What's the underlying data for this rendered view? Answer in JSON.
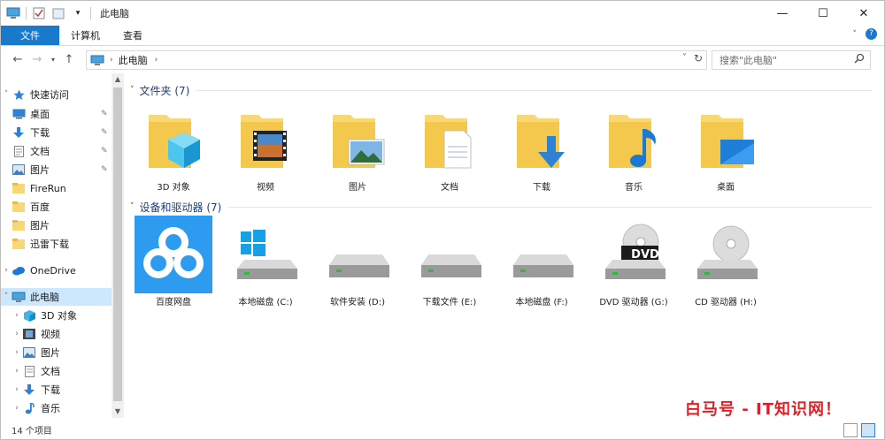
{
  "window": {
    "title": "此电脑",
    "minimize": "—",
    "maximize": "☐",
    "close": "✕"
  },
  "ribbon": {
    "tabs": [
      "文件",
      "计算机",
      "查看"
    ],
    "help": "?"
  },
  "address": {
    "crumb": "此电脑",
    "chevron": "›"
  },
  "search": {
    "placeholder": "搜索\"此电脑\""
  },
  "nav": {
    "quick_access": "快速访问",
    "quick_items": [
      "桌面",
      "下载",
      "文档",
      "图片",
      "FireRun",
      "百度",
      "图片",
      "迅雷下载"
    ],
    "onedrive": "OneDrive",
    "this_pc": "此电脑",
    "pc_items": [
      "3D 对象",
      "视频",
      "图片",
      "文档",
      "下载",
      "音乐"
    ]
  },
  "groups": {
    "folders_title": "文件夹 (7)",
    "devices_title": "设备和驱动器 (7)"
  },
  "folders": [
    {
      "label": "3D 对象",
      "icon": "3d-objects-folder-icon"
    },
    {
      "label": "视频",
      "icon": "videos-folder-icon"
    },
    {
      "label": "图片",
      "icon": "pictures-folder-icon"
    },
    {
      "label": "文档",
      "icon": "documents-folder-icon"
    },
    {
      "label": "下载",
      "icon": "downloads-folder-icon"
    },
    {
      "label": "音乐",
      "icon": "music-folder-icon"
    },
    {
      "label": "桌面",
      "icon": "desktop-folder-icon"
    }
  ],
  "devices": [
    {
      "label": "百度网盘",
      "icon": "baidu-netdisk-icon"
    },
    {
      "label": "本地磁盘 (C:)",
      "icon": "system-drive-icon"
    },
    {
      "label": "软件安装 (D:)",
      "icon": "hard-drive-icon"
    },
    {
      "label": "下载文件 (E:)",
      "icon": "hard-drive-icon"
    },
    {
      "label": "本地磁盘 (F:)",
      "icon": "hard-drive-icon"
    },
    {
      "label": "DVD 驱动器 (G:)",
      "icon": "dvd-drive-icon"
    },
    {
      "label": "CD 驱动器 (H:)",
      "icon": "cd-drive-icon"
    }
  ],
  "dvd_badge": "DVD",
  "status": {
    "count": "14 个项目"
  },
  "watermark": "白马号 - IT知识网！",
  "colors": {
    "accent": "#1979ca",
    "folder": "#f8d775",
    "selection": "#cce8ff",
    "watermark": "#e21f26"
  }
}
